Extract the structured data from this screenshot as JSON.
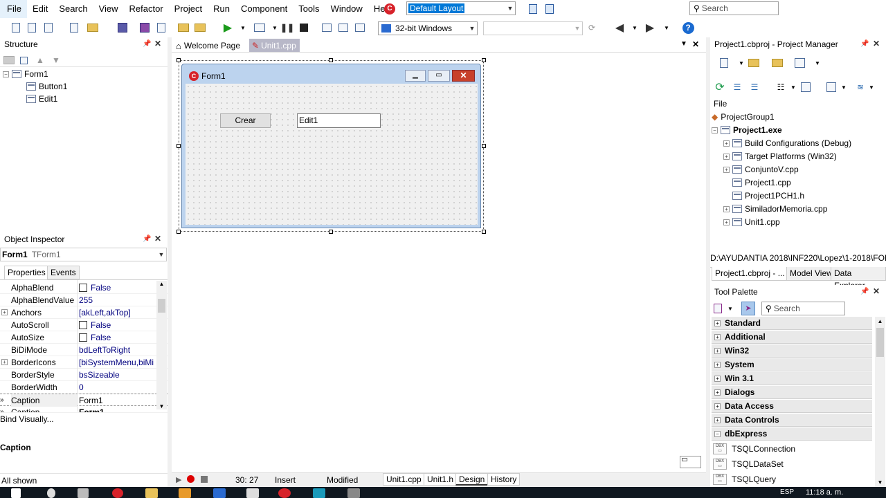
{
  "menubar": {
    "items": [
      "File",
      "Edit",
      "Search",
      "View",
      "Refactor",
      "Project",
      "Run",
      "Component",
      "Tools",
      "Window",
      "Help"
    ],
    "layout_value": "Default Layout",
    "search_placeholder": "Search"
  },
  "toolbar": {
    "platform": "32-bit Windows",
    "config": ""
  },
  "structure": {
    "title": "Structure",
    "root": "Form1",
    "children": [
      "Button1",
      "Edit1"
    ]
  },
  "object_inspector": {
    "title": "Object Inspector",
    "selected_name": "Form1",
    "selected_type": "TForm1",
    "tabs": [
      "Properties",
      "Events"
    ],
    "rows": [
      {
        "name": "AlphaBlend",
        "value": "False",
        "check": true,
        "expand": false
      },
      {
        "name": "AlphaBlendValue",
        "value": "255",
        "check": false,
        "expand": false
      },
      {
        "name": "Anchors",
        "value": "[akLeft,akTop]",
        "check": false,
        "expand": true
      },
      {
        "name": "AutoScroll",
        "value": "False",
        "check": true,
        "expand": false
      },
      {
        "name": "AutoSize",
        "value": "False",
        "check": true,
        "expand": false
      },
      {
        "name": "BiDiMode",
        "value": "bdLeftToRight",
        "check": false,
        "expand": false
      },
      {
        "name": "BorderIcons",
        "value": "[biSystemMenu,biMi",
        "check": false,
        "expand": true
      },
      {
        "name": "BorderStyle",
        "value": "bsSizeable",
        "check": false,
        "expand": false
      },
      {
        "name": "BorderWidth",
        "value": "0",
        "check": false,
        "expand": false
      },
      {
        "name": "Caption",
        "value": "Form1",
        "check": false,
        "expand": false
      },
      {
        "name": "Caption",
        "value": "Form1",
        "check": false,
        "expand": false
      }
    ],
    "bind_visually": "Bind Visually...",
    "description_title": "Caption",
    "status": "All shown"
  },
  "editor": {
    "tabs": [
      "Welcome Page",
      "Unit1.cpp"
    ],
    "form_caption": "Form1",
    "button_caption": "Crear",
    "edit_text": "Edit1",
    "cursor_pos": "30: 27",
    "insert_mode": "Insert",
    "modified": "Modified",
    "bottom_tabs": [
      "Unit1.cpp",
      "Unit1.h",
      "Design",
      "History"
    ]
  },
  "project_manager": {
    "title": "Project1.cbproj - Project Manager",
    "column": "File",
    "group": "ProjectGroup1",
    "project": "Project1.exe",
    "items": [
      {
        "label": "Build Configurations (Debug)",
        "expand": true
      },
      {
        "label": "Target Platforms (Win32)",
        "expand": true
      },
      {
        "label": "ConjuntoV.cpp",
        "expand": true
      },
      {
        "label": "Project1.cpp",
        "expand": false
      },
      {
        "label": "Project1PCH1.h",
        "expand": false
      },
      {
        "label": "SimiladorMemoria.cpp",
        "expand": true
      },
      {
        "label": "Unit1.cpp",
        "expand": true
      }
    ],
    "path": "D:\\AYUDANTIA 2018\\INF220\\Lopez\\1-2018\\FOR",
    "tabs": [
      "Project1.cbproj - ...",
      "Model View",
      "Data Explorer"
    ]
  },
  "tool_palette": {
    "title": "Tool Palette",
    "search_placeholder": "Search",
    "categories": [
      "Standard",
      "Additional",
      "Win32",
      "System",
      "Win 3.1",
      "Dialogs",
      "Data Access",
      "Data Controls",
      "dbExpress"
    ],
    "dbx_items": [
      "TSQLConnection",
      "TSQLDataSet",
      "TSQLQuery"
    ]
  },
  "taskbar": {
    "lang": "ESP",
    "time": "11:18 a. m."
  }
}
